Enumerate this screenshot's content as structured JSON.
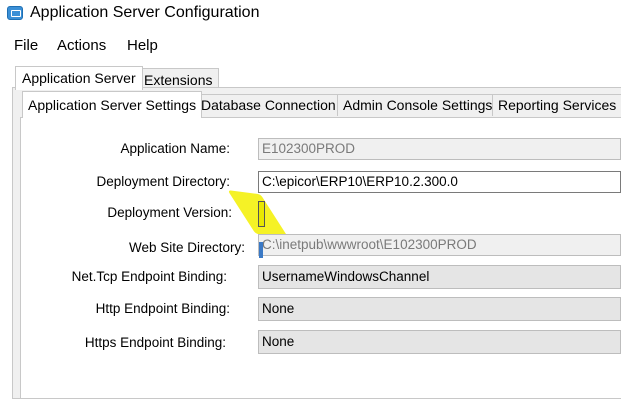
{
  "window": {
    "title": "Application Server Configuration",
    "icon": "app-window-icon"
  },
  "menu": {
    "items": [
      "File",
      "Actions",
      "Help"
    ]
  },
  "outer_tabs": [
    {
      "label": "Application Server",
      "active": true
    },
    {
      "label": "Extensions",
      "active": false
    }
  ],
  "inner_tabs": [
    {
      "label": "Application Server Settings",
      "active": true
    },
    {
      "label": "Database Connection",
      "active": false
    },
    {
      "label": "Admin Console Settings",
      "active": false
    },
    {
      "label": "Reporting Services",
      "active": false
    }
  ],
  "fields": [
    {
      "label": "Application Name:",
      "value": "E102300PROD",
      "kind": "readonly"
    },
    {
      "label": "Deployment Directory:",
      "value": "C:\\epicor\\ERP10\\ERP10.2.300.0",
      "kind": "editable"
    },
    {
      "label": "Deployment Version:",
      "value": "",
      "kind": "highlighted"
    },
    {
      "label": "Web Site Directory:",
      "value": "C:\\inetpub\\wwwroot\\E102300PROD",
      "kind": "readonly"
    },
    {
      "label": "Net.Tcp Endpoint Binding:",
      "value": "UsernameWindowsChannel",
      "kind": "combo"
    },
    {
      "label": "Http Endpoint Binding:",
      "value": "None",
      "kind": "combo"
    },
    {
      "label": "Https Endpoint Binding:",
      "value": "None",
      "kind": "combo"
    }
  ],
  "colors": {
    "highlight": "#f3f000",
    "caret": "#3b79c5",
    "tab_bg": "#f0f0f0"
  }
}
